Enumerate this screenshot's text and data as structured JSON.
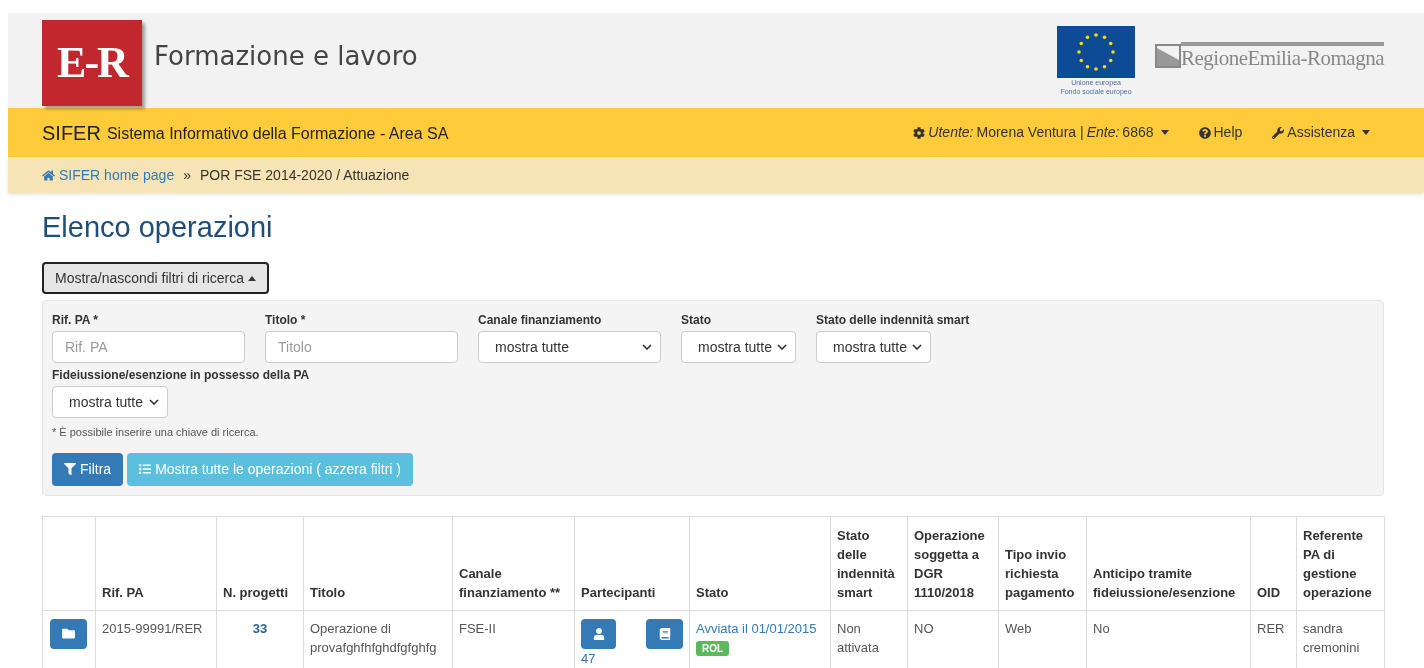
{
  "header": {
    "logo_text": "E-R",
    "title": "Formazione e lavoro",
    "eu_caption": [
      "Unione europea",
      "Fondo sociale europeo"
    ],
    "region_logo_text": "RegioneEmilia-Romagna"
  },
  "navbar": {
    "brand": "SIFER",
    "subtitle": "Sistema Informativo della Formazione - Area SA",
    "user_label": "Utente:",
    "user_name": "Morena Ventura",
    "separator": "|",
    "ente_label": "Ente:",
    "ente": "6868",
    "help": "Help",
    "assistenza": "Assistenza"
  },
  "breadcrumb": {
    "home": "SIFER home page",
    "separator": "»",
    "current": "POR FSE 2014-2020 / Attuazione"
  },
  "page_title": "Elenco operazioni",
  "filter_toggle": {
    "label": "Mostra/nascondi filtri di ricerca",
    "expanded": true
  },
  "filters": [
    {
      "kind": "text",
      "label": "Rif. PA *",
      "placeholder": "Rif. PA"
    },
    {
      "kind": "text",
      "label": "Titolo *",
      "placeholder": "Titolo"
    },
    {
      "kind": "select",
      "label": "Canale finanziamento",
      "value": "mostra tutte"
    },
    {
      "kind": "select",
      "label": "Stato",
      "value": "mostra tutte"
    },
    {
      "kind": "select",
      "label": "Stato delle indennità smart",
      "value": "mostra tutte"
    },
    {
      "kind": "select",
      "label": "Fideiussione/esenzione in possesso della PA",
      "value": "mostra tutte"
    }
  ],
  "filter_note": "* È possibile inserire una chiave di ricerca.",
  "filter_buttons": [
    {
      "kind": "primary",
      "label": "Filtra"
    },
    {
      "kind": "info",
      "label": "Mostra tutte le operazioni ( azzera filtri )"
    }
  ],
  "table": {
    "columns": [
      "",
      "Rif. PA",
      "N. progetti",
      "Titolo",
      "Canale finanziamento **",
      "Partecipanti",
      "Stato",
      "Stato delle indennità smart",
      "Operazione soggetta a DGR 1110/2018",
      "Tipo invio richiesta pagamento",
      "Anticipo tramite fideiussione/esenzione",
      "OID",
      "Referente PA di gestione operazione"
    ],
    "rows": [
      {
        "rif_pa": "2015-99991/RER",
        "n_progetti": "33",
        "titolo": "Operazione di provafghfhfghdfgfghfg",
        "canale": "FSE-II",
        "partecipanti": "47",
        "stato": "Avviata il 01/01/2015",
        "stato_badge": "ROL",
        "smart": "Non attivata",
        "dgr": "NO",
        "tipo_invio": "Web",
        "anticipo": "No",
        "oid": "RER",
        "referente": "sandra cremonini"
      }
    ]
  }
}
